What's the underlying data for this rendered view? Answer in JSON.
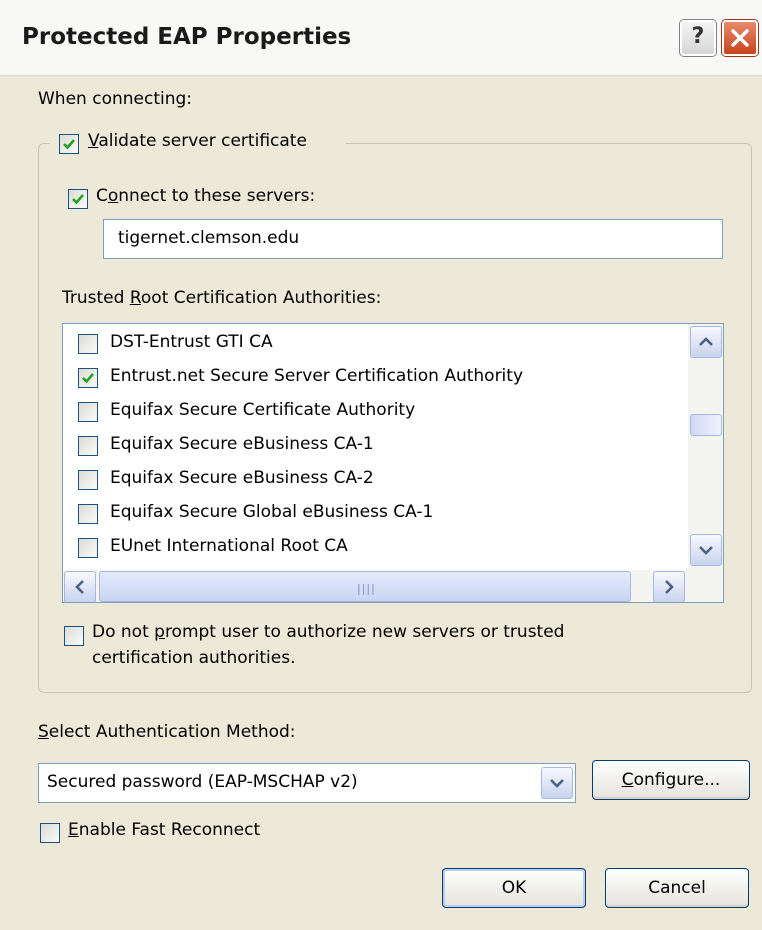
{
  "window": {
    "title": "Protected EAP Properties",
    "help_glyph": "?",
    "close_icon": "close-icon"
  },
  "when_connecting_label": "When connecting:",
  "validate_server_certificate": {
    "checked": true,
    "key": "V",
    "rest": "alidate server certificate"
  },
  "connect_to_servers": {
    "checked": true,
    "pre": "C",
    "key": "o",
    "rest": "nnect to these servers:",
    "value": "tigernet.clemson.edu"
  },
  "trusted_root": {
    "pre": "Trusted ",
    "key": "R",
    "rest": "oot Certification Authorities:",
    "items": [
      {
        "label": "DST-Entrust GTI CA",
        "checked": false
      },
      {
        "label": "Entrust.net Secure Server Certification Authority",
        "checked": true
      },
      {
        "label": "Equifax Secure Certificate Authority",
        "checked": false
      },
      {
        "label": "Equifax Secure eBusiness CA-1",
        "checked": false
      },
      {
        "label": "Equifax Secure eBusiness CA-2",
        "checked": false
      },
      {
        "label": "Equifax Secure Global eBusiness CA-1",
        "checked": false
      },
      {
        "label": "EUnet International Root CA",
        "checked": false
      }
    ]
  },
  "do_not_prompt": {
    "checked": false,
    "pre": "Do not ",
    "key": "p",
    "rest": "rompt user to authorize new servers or trusted",
    "line2": "certification authorities."
  },
  "auth_method": {
    "key": "S",
    "rest": "elect Authentication Method:",
    "selected": "Secured password (EAP-MSCHAP v2)",
    "configure_key": "C",
    "configure_rest": "onfigure..."
  },
  "fast_reconnect": {
    "checked": false,
    "key": "E",
    "rest": "nable Fast Reconnect"
  },
  "buttons": {
    "ok": "OK",
    "cancel": "Cancel"
  }
}
